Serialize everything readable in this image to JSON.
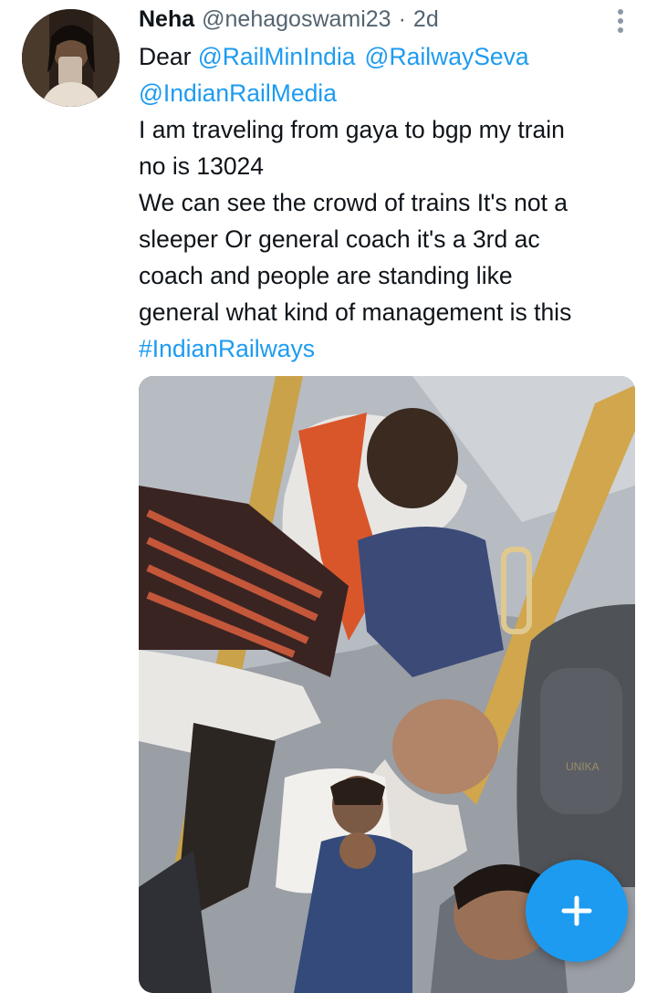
{
  "tweet": {
    "author_name": "Neha",
    "handle": "@nehagoswami23",
    "separator": "·",
    "time": "2d",
    "greeting": "Dear",
    "mentions": [
      "@RailMinIndia",
      "@RailwaySeva",
      "@IndianRailMedia"
    ],
    "lines": [
      "I am traveling from gaya to bgp my train",
      "no is 13024",
      "We can see the crowd of trains It's not a",
      "sleeper Or general coach it's a 3rd ac",
      "coach and people are standing like",
      "general what kind of management is this"
    ],
    "hashtag": "#IndianRailways",
    "media_label": "Photo of crowded 3rd AC train coach",
    "bag_brand": "UNIKA"
  },
  "icons": {
    "more": "more-vertical-icon",
    "compose": "plus-icon"
  },
  "colors": {
    "link": "#1d9bf0",
    "fab": "#1d9bf0",
    "secondary_text": "#536471"
  }
}
